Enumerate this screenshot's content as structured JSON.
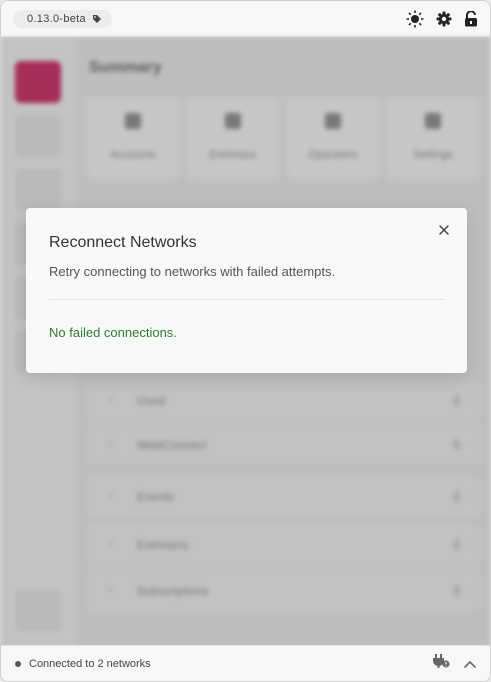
{
  "topbar": {
    "version": "0.13.0-beta",
    "icons": [
      "tag-icon",
      "sun-icon",
      "gear-icon",
      "unlock-icon"
    ]
  },
  "background": {
    "summary_title": "Summary",
    "tiles": [
      "Accounts",
      "Extrinsics",
      "Operators",
      "Settings"
    ],
    "rows": [
      "Used",
      "WebConnect",
      "Events",
      "Extrinsics",
      "Subscriptions"
    ],
    "row_counts": [
      "0",
      "0",
      "0",
      "0",
      "0"
    ]
  },
  "modal": {
    "title": "Reconnect Networks",
    "description": "Retry connecting to networks with failed attempts.",
    "status": "No failed connections.",
    "status_color": "#2e7d32"
  },
  "statusbar": {
    "connection_text": "Connected to 2 networks",
    "icons": [
      "plug-icon",
      "chevron-up-icon"
    ]
  },
  "colors": {
    "accent": "#b7164f"
  }
}
